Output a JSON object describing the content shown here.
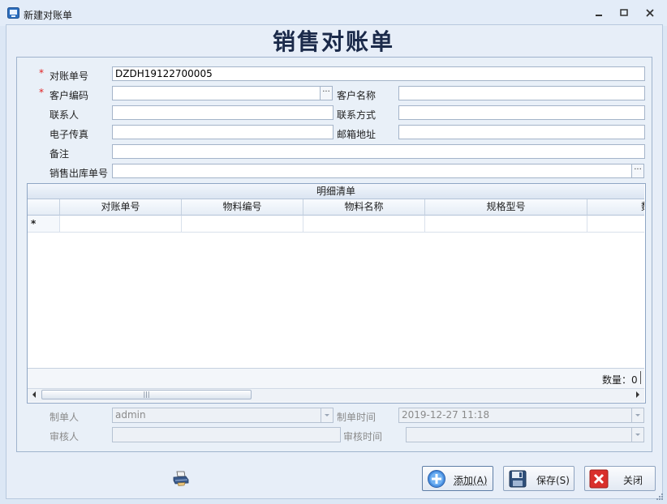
{
  "window": {
    "title": "新建对账单"
  },
  "header": {
    "title": "销售对账单"
  },
  "form": {
    "recon_no_label": "对账单号",
    "recon_no_value": "DZDH19122700005",
    "customer_code_label": "客户编码",
    "customer_code_value": "",
    "customer_name_label": "客户名称",
    "customer_name_value": "",
    "contact_label": "联系人",
    "contact_value": "",
    "contact_method_label": "联系方式",
    "contact_method_value": "",
    "fax_label": "电子传真",
    "fax_value": "",
    "email_label": "邮箱地址",
    "email_value": "",
    "remark_label": "备注",
    "remark_value": "",
    "sales_out_no_label": "销售出库单号",
    "sales_out_no_value": "",
    "required_mark": "*",
    "ellipsis": "···"
  },
  "grid": {
    "caption": "明细清单",
    "columns": [
      "对账单号",
      "物料编号",
      "物料名称",
      "规格型号",
      "数"
    ],
    "new_row_marker": "*",
    "footer_label": "数量：0",
    "scroll_grip": "|||"
  },
  "audit": {
    "creator_label": "制单人",
    "creator_value": "admin",
    "create_time_label": "制单时间",
    "create_time_value": "2019-12-27 11:18",
    "reviewer_label": "审核人",
    "reviewer_value": "",
    "review_time_label": "审核时间",
    "review_time_value": ""
  },
  "buttons": {
    "add_label": "添加(A)",
    "save_label": "保存(S)",
    "close_label": "关闭"
  },
  "colors": {
    "accent": "#1b2a4a",
    "required": "#e02020",
    "close_red": "#d9302c",
    "add_blue": "#3b7fd4"
  }
}
